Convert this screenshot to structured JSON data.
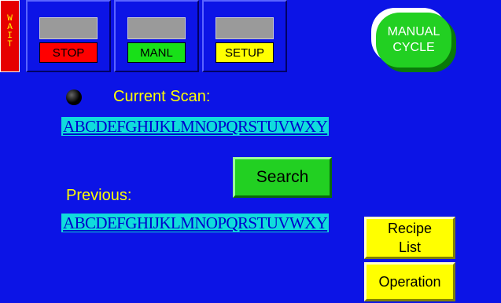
{
  "status": {
    "wait_letters": [
      "W",
      "A",
      "I",
      "T"
    ]
  },
  "mode_buttons": [
    {
      "label": "STOP",
      "color": "#ff0000"
    },
    {
      "label": "MANL",
      "color": "#18e018"
    },
    {
      "label": "SETUP",
      "color": "#ffff00"
    }
  ],
  "manual_cycle": {
    "line1": "MANUAL",
    "line2": "CYCLE",
    "color": "#22d022"
  },
  "scan": {
    "indicator_icon": "black-dot-icon",
    "current_label": "Current Scan:",
    "current_value": "ABCDEFGHIJKLMNOPQRSTUVWXY",
    "previous_label": "Previous:",
    "previous_value": "ABCDEFGHIJKLMNOPQRSTUVWXY"
  },
  "actions": {
    "search_label": "Search",
    "recipe_line1": "Recipe",
    "recipe_line2": "List",
    "operation_label": "Operation"
  },
  "colors": {
    "background": "#0c14e6",
    "label_text": "#ffff00",
    "scan_highlight": "#10dcdc"
  }
}
